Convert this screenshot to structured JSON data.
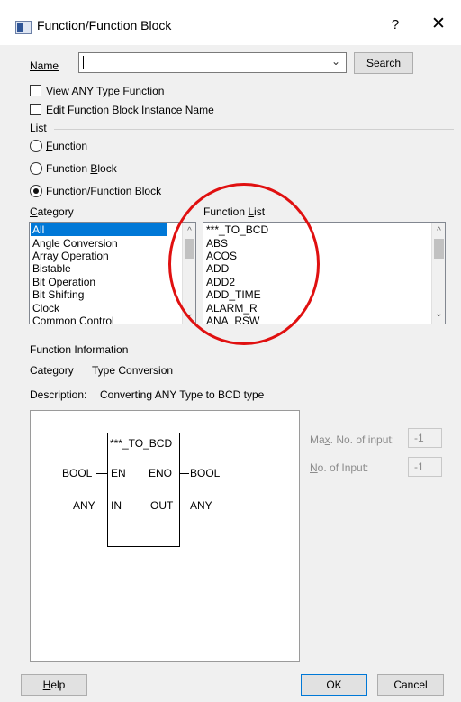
{
  "window": {
    "title": "Function/Function Block",
    "help_glyph": "?",
    "close_glyph": "✕"
  },
  "name_field": {
    "label": "Name",
    "value": "",
    "placeholder": "",
    "search_label": "Search"
  },
  "checkboxes": {
    "view_any_type": {
      "label": "View ANY Type Function",
      "checked": false
    },
    "edit_fb_instance": {
      "label": "Edit Function Block Instance Name",
      "checked": false
    }
  },
  "list_group": {
    "title": "List",
    "radios": [
      {
        "label": "Function",
        "selected": false
      },
      {
        "label": "Function Block",
        "selected": false
      },
      {
        "label": "Function/Function Block",
        "selected": true
      }
    ]
  },
  "category": {
    "header": "Category",
    "items": [
      "All",
      "Angle Conversion",
      "Array Operation",
      "Bistable",
      "Bit Operation",
      "Bit Shifting",
      "Clock",
      "Common Control"
    ],
    "selected": "All"
  },
  "function_list": {
    "header": "Function List",
    "items": [
      "***_TO_BCD",
      "ABS",
      "ACOS",
      "ADD",
      "ADD2",
      "ADD_TIME",
      "ALARM_R",
      "ANA_RSW"
    ]
  },
  "function_info": {
    "title": "Function Information",
    "category_label": "Category",
    "category_value": "Type Conversion",
    "description_label": "Description:",
    "description_value": "Converting ANY Type to BCD type"
  },
  "block_diagram": {
    "block_name": "***_TO_BCD",
    "in_pins": [
      {
        "pin": "EN",
        "type": "BOOL"
      },
      {
        "pin": "IN",
        "type": "ANY"
      }
    ],
    "out_pins": [
      {
        "pin": "ENO",
        "type": "BOOL"
      },
      {
        "pin": "OUT",
        "type": "ANY"
      }
    ]
  },
  "inputs_panel": {
    "max_inputs_label": "Max. No. of input:",
    "max_inputs_value": "-1",
    "num_inputs_label": "No. of Input:",
    "num_inputs_value": "-1"
  },
  "footer": {
    "help_label": "Help",
    "ok_label": "OK",
    "cancel_label": "Cancel"
  },
  "colors": {
    "selection": "#0078d7",
    "annotation_circle": "#e01010"
  }
}
